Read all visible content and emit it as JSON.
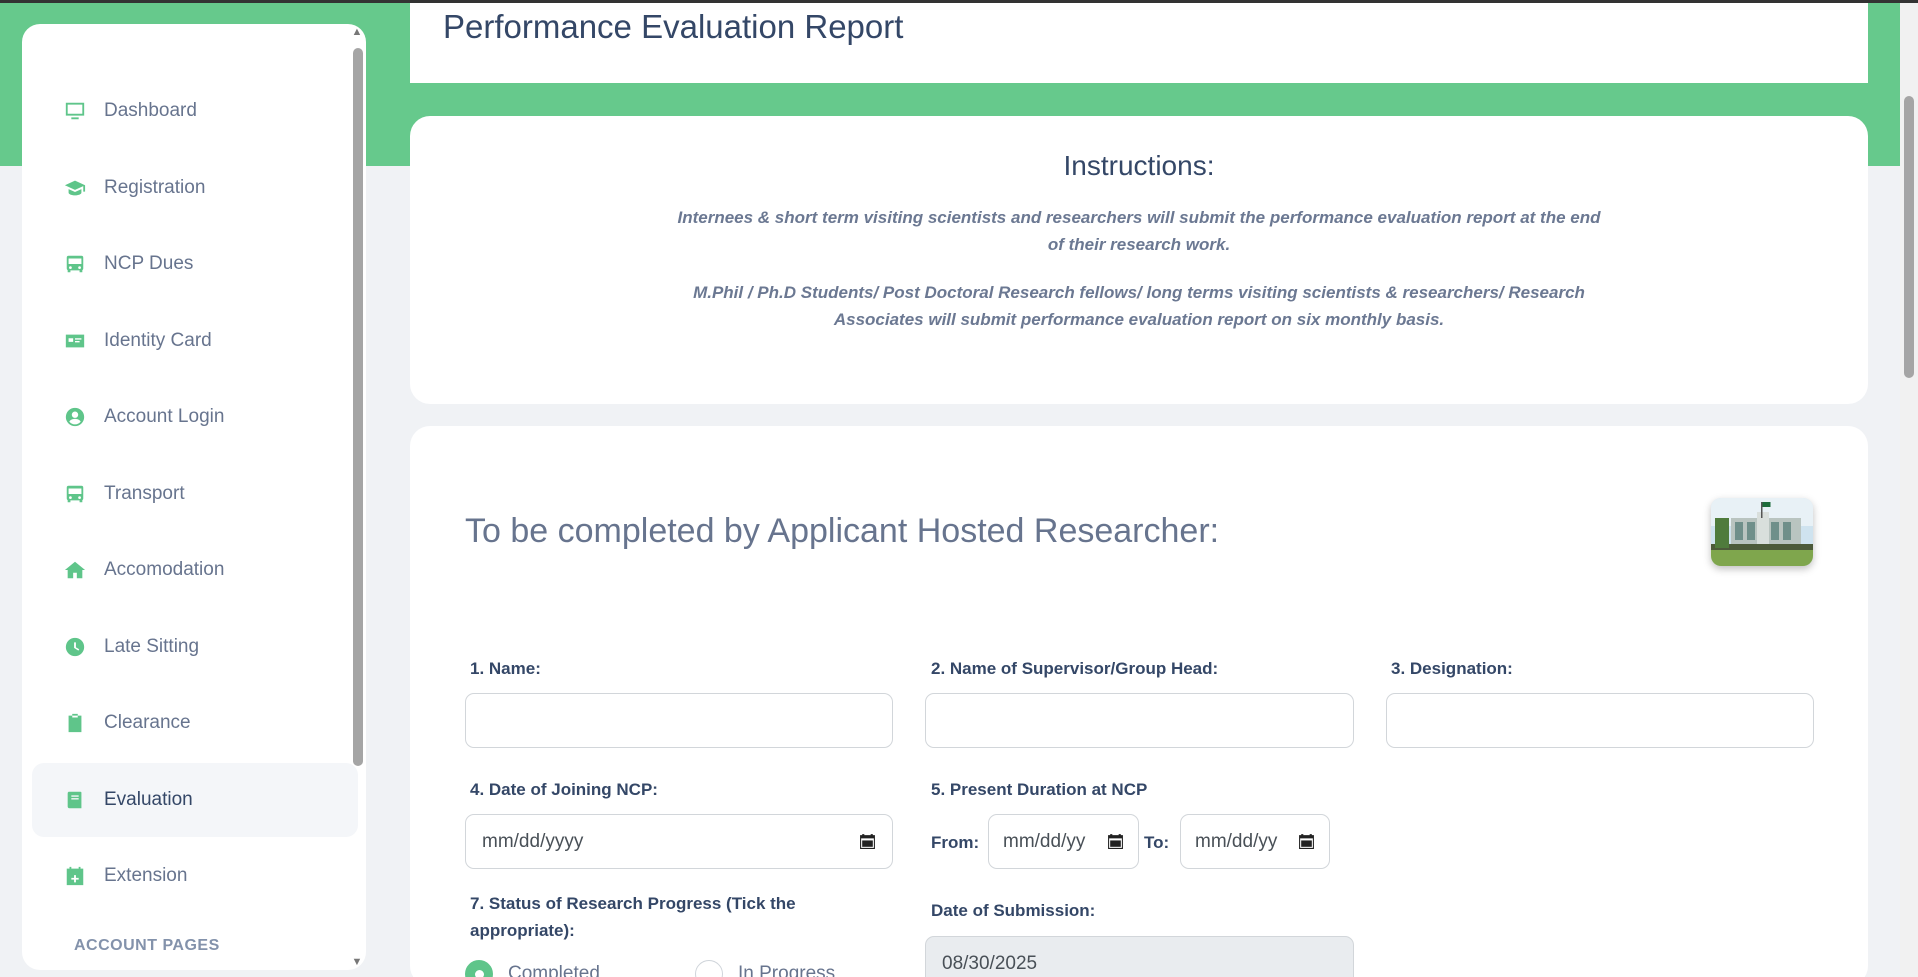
{
  "page": {
    "title": "Performance Evaluation Report"
  },
  "sidebar": {
    "items": [
      {
        "label": "Dashboard",
        "icon": "monitor-icon"
      },
      {
        "label": "Registration",
        "icon": "graduation-cap-icon"
      },
      {
        "label": "NCP Dues",
        "icon": "bus-icon"
      },
      {
        "label": "Identity Card",
        "icon": "id-card-icon"
      },
      {
        "label": "Account Login",
        "icon": "user-circle-icon"
      },
      {
        "label": "Transport",
        "icon": "bus-icon"
      },
      {
        "label": "Accomodation",
        "icon": "home-icon"
      },
      {
        "label": "Late Sitting",
        "icon": "clock-icon"
      },
      {
        "label": "Clearance",
        "icon": "clipboard-icon"
      },
      {
        "label": "Evaluation",
        "icon": "book-icon",
        "active": true
      },
      {
        "label": "Extension",
        "icon": "calendar-plus-icon"
      }
    ],
    "section_label": "ACCOUNT PAGES"
  },
  "instructions": {
    "heading": "Instructions:",
    "para1": "Internees & short term visiting scientists and researchers will submit the performance evaluation report at the end of their research work.",
    "para2": "M.Phil / Ph.D Students/ Post Doctoral Research fellows/ long terms visiting scientists & researchers/ Research Associates will submit performance evaluation report on six monthly basis."
  },
  "form": {
    "heading": "To be completed by Applicant Hosted Researcher:",
    "name_label": "1. Name:",
    "supervisor_label": "2. Name of Supervisor/Group Head:",
    "designation_label": "3. Designation:",
    "joining_label": "4. Date of Joining NCP:",
    "joining_placeholder": "mm/dd/yyyy",
    "duration_label": "5. Present Duration at NCP",
    "from_label": "From:",
    "from_placeholder": "mm/dd/yy",
    "to_label": "To:",
    "to_placeholder": "mm/dd/yy",
    "status_label": "7. Status of Research Progress (Tick the appropriate):",
    "status_options": [
      {
        "label": "Completed",
        "checked": true
      },
      {
        "label": "In Progress",
        "checked": false
      }
    ],
    "submission_label": "Date of Submission:",
    "submission_value": "08/30/2025"
  },
  "colors": {
    "accent": "#5fc58a",
    "band": "#66c98c"
  }
}
